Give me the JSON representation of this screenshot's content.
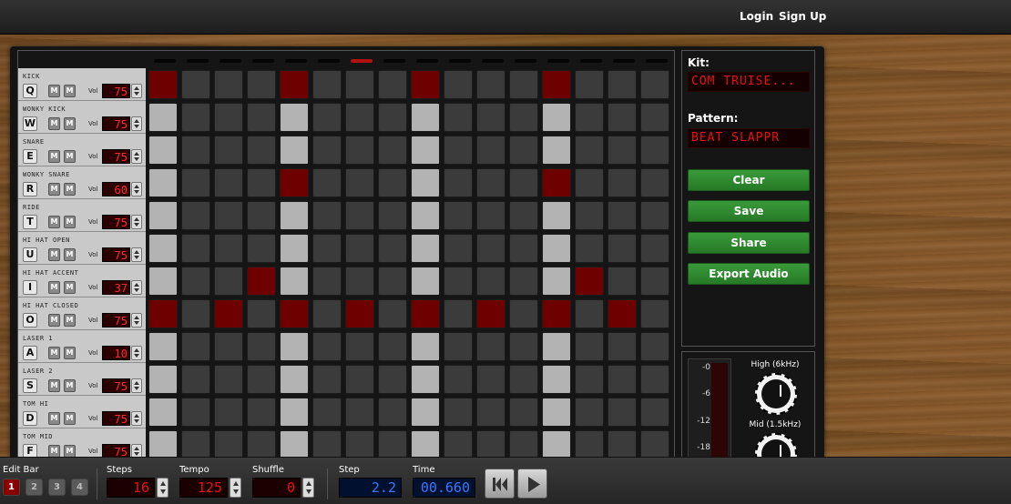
{
  "header": {
    "login": "Login",
    "signup": "Sign Up"
  },
  "tracks": [
    {
      "name": "KICK",
      "key": "Q",
      "vol": "75",
      "steps": [
        1,
        0,
        0,
        0,
        1,
        0,
        0,
        0,
        1,
        0,
        0,
        0,
        1,
        0,
        0,
        0
      ]
    },
    {
      "name": "WONKY KICK",
      "key": "W",
      "vol": "75",
      "steps": [
        0,
        0,
        0,
        0,
        0,
        0,
        0,
        0,
        0,
        0,
        0,
        0,
        0,
        0,
        0,
        0
      ]
    },
    {
      "name": "SNARE",
      "key": "E",
      "vol": "75",
      "steps": [
        0,
        0,
        0,
        0,
        0,
        0,
        0,
        0,
        0,
        0,
        0,
        0,
        0,
        0,
        0,
        0
      ]
    },
    {
      "name": "WONKY SNARE",
      "key": "R",
      "vol": "60",
      "steps": [
        0,
        0,
        0,
        0,
        1,
        0,
        0,
        0,
        0,
        0,
        0,
        0,
        1,
        0,
        0,
        0
      ]
    },
    {
      "name": "RIDE",
      "key": "T",
      "vol": "75",
      "steps": [
        0,
        0,
        0,
        0,
        0,
        0,
        0,
        0,
        0,
        0,
        0,
        0,
        0,
        0,
        0,
        0
      ]
    },
    {
      "name": "HI HAT OPEN",
      "key": "U",
      "vol": "75",
      "steps": [
        0,
        0,
        0,
        0,
        0,
        0,
        0,
        0,
        0,
        0,
        0,
        0,
        0,
        0,
        0,
        0
      ]
    },
    {
      "name": "HI HAT ACCENT",
      "key": "I",
      "vol": "37",
      "steps": [
        0,
        0,
        0,
        1,
        0,
        0,
        0,
        0,
        0,
        0,
        0,
        0,
        0,
        1,
        0,
        0
      ]
    },
    {
      "name": "HI HAT CLOSED",
      "key": "O",
      "vol": "75",
      "steps": [
        1,
        0,
        1,
        0,
        1,
        0,
        1,
        0,
        1,
        0,
        1,
        0,
        1,
        0,
        1,
        0
      ]
    },
    {
      "name": "LASER 1",
      "key": "A",
      "vol": "10",
      "steps": [
        0,
        0,
        0,
        0,
        0,
        0,
        0,
        0,
        0,
        0,
        0,
        0,
        0,
        0,
        0,
        0
      ]
    },
    {
      "name": "LASER 2",
      "key": "S",
      "vol": "75",
      "steps": [
        0,
        0,
        0,
        0,
        0,
        0,
        0,
        0,
        0,
        0,
        0,
        0,
        0,
        0,
        0,
        0
      ]
    },
    {
      "name": "TOM HI",
      "key": "D",
      "vol": "75",
      "steps": [
        0,
        0,
        0,
        0,
        0,
        0,
        0,
        0,
        0,
        0,
        0,
        0,
        0,
        0,
        0,
        0
      ]
    },
    {
      "name": "TOM MID",
      "key": "F",
      "vol": "75",
      "steps": [
        0,
        0,
        0,
        0,
        0,
        0,
        0,
        0,
        0,
        0,
        0,
        0,
        0,
        0,
        0,
        0
      ]
    }
  ],
  "track_controls": {
    "mute": "M",
    "solo": "M",
    "vol_label": "Vol"
  },
  "current_step": 6,
  "side": {
    "kit_label": "Kit:",
    "kit_value": "COM TRUISE...",
    "pattern_label": "Pattern:",
    "pattern_value": "BEAT SLAPPR",
    "clear": "Clear",
    "save": "Save",
    "share": "Share",
    "export": "Export Audio"
  },
  "fx": {
    "meter_labels": [
      "-0",
      "-6",
      "-12",
      "-18"
    ],
    "high_label": "High (6kHz)",
    "mid_label": "Mid (1.5kHz)"
  },
  "bottom": {
    "edit_bar_label": "Edit Bar",
    "bars": [
      "1",
      "2",
      "3",
      "4"
    ],
    "active_bar": 0,
    "steps_label": "Steps",
    "steps_value": "16",
    "tempo_label": "Tempo",
    "tempo_value": "125",
    "shuffle_label": "Shuffle",
    "shuffle_value": "0",
    "step_label": "Step",
    "step_value": "2.2",
    "time_label": "Time",
    "time_value": "00.660"
  },
  "colors": {
    "active_step": "#6f0000",
    "beat_step": "#b3b3b3",
    "button_green": "#2d8a2d",
    "led_red": "#e81010",
    "led_blue": "#3a78ff"
  }
}
